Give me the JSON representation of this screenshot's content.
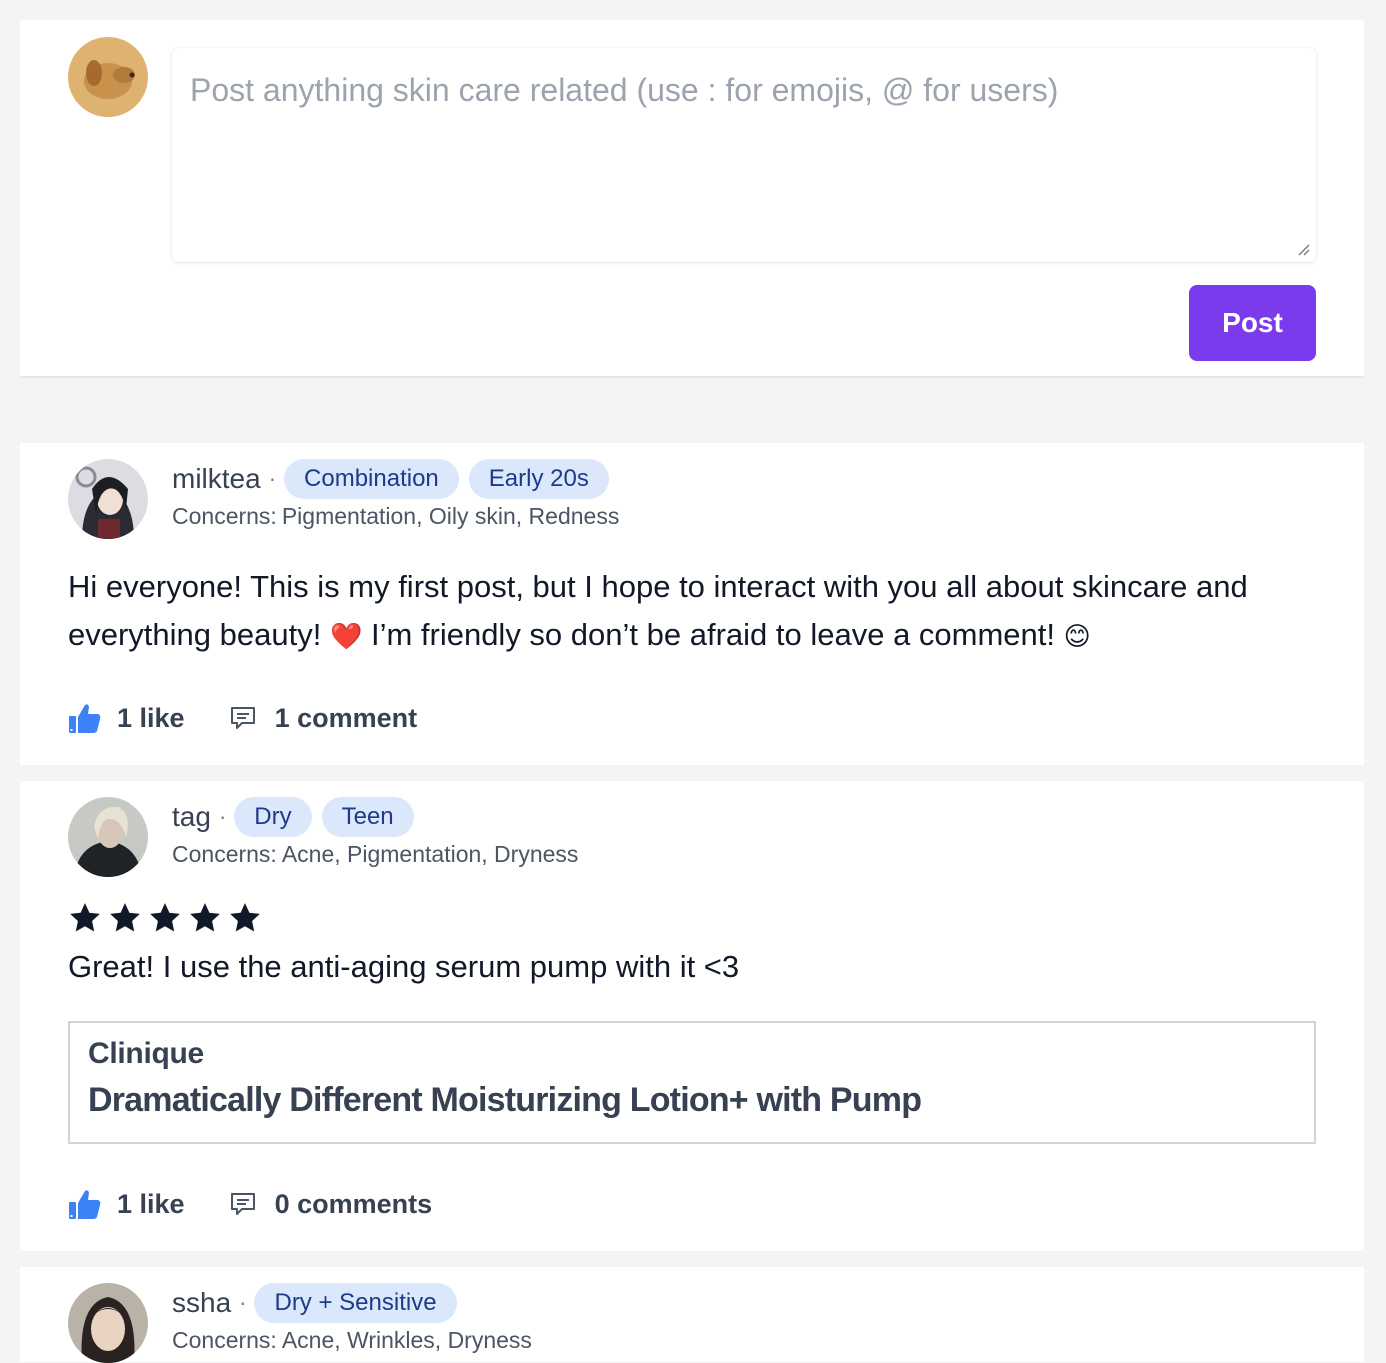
{
  "composer": {
    "placeholder": "Post anything skin care related (use : for emojis, @ for users)",
    "post_label": "Post"
  },
  "posts": [
    {
      "username": "milktea",
      "separator": "·",
      "chips": [
        "Combination",
        "Early 20s"
      ],
      "concerns_label": "Concerns:",
      "concerns": "Pigmentation, Oily skin, Redness",
      "text_line1": "Hi everyone! This is my first post, but I hope to interact with you all about skincare and",
      "text_line2a": "everything beauty!",
      "emoji_heart": "❤️",
      "text_line2b": "I’m friendly so don’t be afraid to leave a comment!",
      "emoji_smile": "😊",
      "likes": "1 like",
      "comments": "1 comment"
    },
    {
      "username": "tag",
      "separator": "·",
      "chips": [
        "Dry",
        "Teen"
      ],
      "concerns_label": "Concerns:",
      "concerns": "Acne, Pigmentation, Dryness",
      "rating": 5,
      "text": "Great! I use the anti-aging serum pump with it <3",
      "product": {
        "brand": "Clinique",
        "name": "Dramatically Different Moisturizing Lotion+ with Pump"
      },
      "likes": "1 like",
      "comments": "0 comments"
    },
    {
      "username": "ssha",
      "separator": "·",
      "chips": [
        "Dry + Sensitive"
      ],
      "concerns_label": "Concerns:",
      "concerns": "Acne, Wrinkles, Dryness"
    }
  ],
  "colors": {
    "accent": "#7c3aed",
    "chip_bg": "#dbe8fc",
    "chip_text": "#1e3a8a",
    "like_icon": "#3b82f6"
  },
  "icons": {
    "like": "thumbs-up-icon",
    "comment": "comment-icon",
    "star": "star-icon"
  }
}
